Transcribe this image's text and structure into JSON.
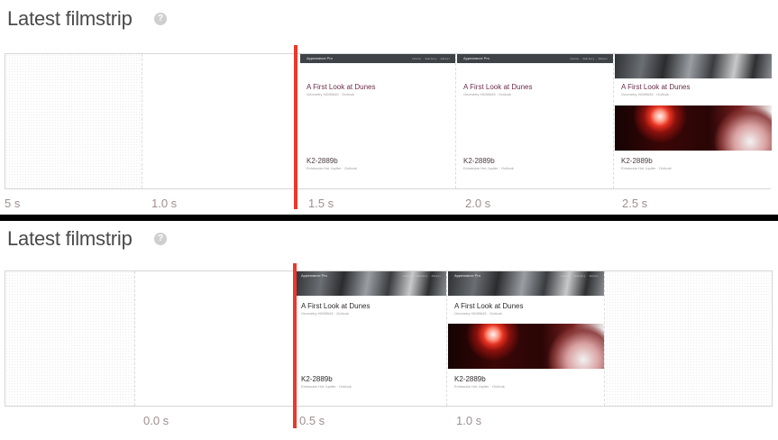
{
  "top_panel": {
    "title": "Latest filmstrip",
    "help_icon": "?",
    "frames": [
      {
        "kind": "dotty"
      },
      {
        "kind": "blank"
      },
      {
        "kind": "page",
        "nav": "plain",
        "brand": "Appearance Pro",
        "links": "Home · Gallery · About",
        "h1": "A First Look at Dunes",
        "sub": "Geometry HD89645 · Outlook",
        "h2": "K2-2889b",
        "sub2": "Extrasolar Hot Jupiter · Outlook",
        "image": false
      },
      {
        "kind": "page",
        "nav": "plain",
        "brand": "Appearance Pro",
        "links": "Home · Gallery · About",
        "h1": "A First Look at Dunes",
        "sub": "Geometry HD89645 · Outlook",
        "h2": "K2-2889b",
        "sub2": "Extrasolar Hot Jupiter · Outlook",
        "image": false
      },
      {
        "kind": "page",
        "nav": "photo",
        "brand": "",
        "links": "",
        "h1": "A First Look at Dunes",
        "sub": "Geometry HD89645 · Outlook",
        "h2": "K2-2889b",
        "sub2": "Extrasolar Hot Jupiter · Outlook",
        "image": true
      }
    ],
    "times": [
      "5 s",
      "1.0 s",
      "1.5 s",
      "2.0 s",
      "2.5 s"
    ]
  },
  "bottom_panel": {
    "title": "Latest filmstrip",
    "help_icon": "?",
    "frames": [
      {
        "kind": "dotty"
      },
      {
        "kind": "blank"
      },
      {
        "kind": "page",
        "nav": "photo",
        "brand": "Appearance Pro",
        "links": "Home · Gallery · About",
        "h1": "A First Look at Dunes",
        "sub": "Geometry HD89645 · Outlook",
        "h2": "K2-2889b",
        "sub2": "Extrasolar Hot Jupiter · Outlook",
        "image": false
      },
      {
        "kind": "page",
        "nav": "photo",
        "brand": "Appearance Pro",
        "links": "Home · Gallery · About",
        "h1": "A First Look at Dunes",
        "sub": "Geometry HD89645 · Outlook",
        "h2": "K2-2889b",
        "sub2": "Extrasolar Hot Jupiter · Outlook",
        "image": true
      },
      {
        "kind": "dotty"
      }
    ],
    "times": [
      "0.0 s",
      "0.5 s",
      "1.0 s"
    ]
  },
  "colors": {
    "marker": "#e8392a",
    "time_text": "#a08e8e",
    "title_text": "#4a4a4a"
  }
}
